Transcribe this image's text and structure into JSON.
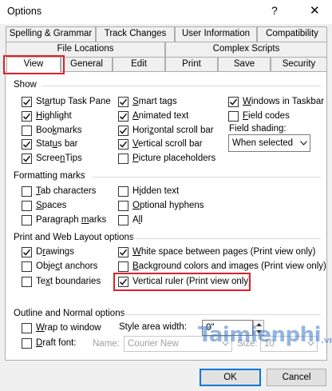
{
  "window": {
    "title": "Options",
    "help": "?",
    "close": "✕"
  },
  "tabs_row1": [
    "Spelling & Grammar",
    "Track Changes",
    "User Information",
    "Compatibility"
  ],
  "tabs_row2": [
    "File Locations",
    "Complex Scripts"
  ],
  "tabs_row3": [
    "View",
    "General",
    "Edit",
    "Print",
    "Save",
    "Security"
  ],
  "selected_tab": "View",
  "show": {
    "label": "Show",
    "col1": [
      {
        "label": "Startup Task Pane",
        "u": "a",
        "checked": true
      },
      {
        "label": "Highlight",
        "u": "H",
        "checked": true
      },
      {
        "label": "Bookmarks",
        "u": "k",
        "checked": false
      },
      {
        "label": "Status bar",
        "u": "u",
        "checked": true
      },
      {
        "label": "ScreenTips",
        "u": "n",
        "checked": true
      }
    ],
    "col2": [
      {
        "label": "Smart tags",
        "u": "S",
        "checked": true
      },
      {
        "label": "Animated text",
        "u": "A",
        "checked": true
      },
      {
        "label": "Horizontal scroll bar",
        "u": "z",
        "checked": true
      },
      {
        "label": "Vertical scroll bar",
        "u": "V",
        "checked": true
      },
      {
        "label": "Picture placeholders",
        "u": "P",
        "checked": false
      }
    ],
    "col3": [
      {
        "label": "Windows in Taskbar",
        "u": "W",
        "checked": true
      },
      {
        "label": "Field codes",
        "u": "F",
        "checked": false
      }
    ],
    "field_shading_label": "Field shading:",
    "field_shading_value": "When selected"
  },
  "formatting": {
    "label": "Formatting marks",
    "col1": [
      {
        "label": "Tab characters",
        "u": "T",
        "checked": false
      },
      {
        "label": "Spaces",
        "u": "S",
        "checked": false
      },
      {
        "label": "Paragraph marks",
        "u": "m",
        "checked": false
      }
    ],
    "col2": [
      {
        "label": "Hidden text",
        "u": "i",
        "checked": false
      },
      {
        "label": "Optional hyphens",
        "u": "O",
        "checked": false
      },
      {
        "label": "All",
        "u": "l",
        "checked": false
      }
    ]
  },
  "print_web": {
    "label": "Print and Web Layout options",
    "col1": [
      {
        "label": "Drawings",
        "u": "r",
        "checked": true
      },
      {
        "label": "Object anchors",
        "u": "c",
        "checked": false
      },
      {
        "label": "Text boundaries",
        "u": "x",
        "checked": false
      }
    ],
    "col2": [
      {
        "label": "White space between pages (Print view only)",
        "u": "W",
        "checked": true
      },
      {
        "label": "Background colors and images (Print view only)",
        "u": "B",
        "checked": false
      },
      {
        "label": "Vertical ruler (Print view only)",
        "u": "C",
        "checked": true
      }
    ]
  },
  "outline": {
    "label": "Outline and Normal options",
    "wrap": {
      "label": "Wrap to window",
      "u": "W",
      "checked": false
    },
    "draft": {
      "label": "Draft font:",
      "u": "D",
      "checked": false
    },
    "style_area_label": "Style area width:",
    "style_area_value": "0\"",
    "name_label": "Name:",
    "name_value": "Courier New",
    "size_label": "Size:",
    "size_value": "10"
  },
  "buttons": {
    "ok": "OK",
    "cancel": "Cancel"
  },
  "watermark": {
    "main": "Taimienphi",
    "tld": ".vn"
  },
  "colors": {
    "highlight_box": "#e0202a",
    "default_button_border": "#0078d7",
    "dialog_bg": "#f0f0f0"
  }
}
